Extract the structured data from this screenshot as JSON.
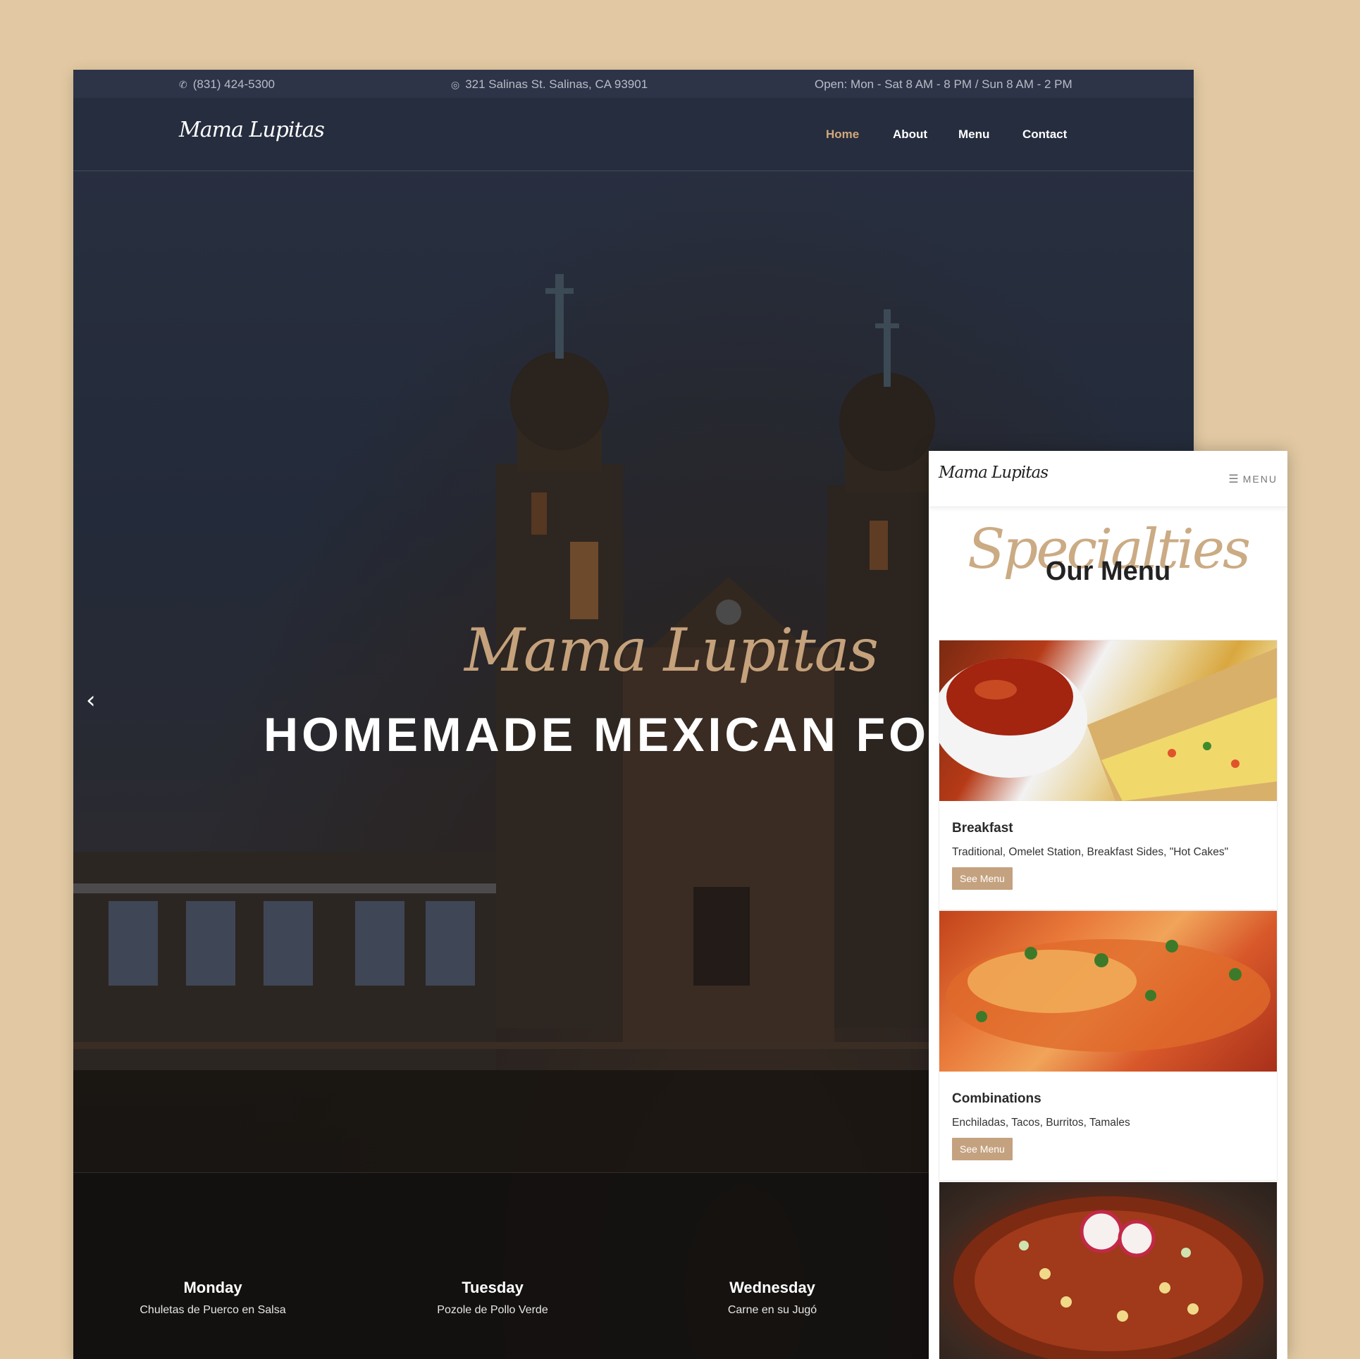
{
  "desktop": {
    "topbar": {
      "phone": "(831) 424-5300",
      "address": "321 Salinas St. Salinas, CA 93901",
      "hours": "Open: Mon - Sat 8 AM - 8 PM / Sun 8 AM - 2 PM"
    },
    "logo": "Mama Lupitas",
    "nav": {
      "home": "Home",
      "about": "About",
      "menu": "Menu",
      "contact": "Contact"
    },
    "hero": {
      "script": "Mama Lupitas",
      "title": "HOMEMADE MEXICAN FOOD",
      "prev_arrow": "‹"
    },
    "specials": [
      {
        "day": "Monday",
        "dish": "Chuletas de Puerco en Salsa"
      },
      {
        "day": "Tuesday",
        "dish": "Pozole de Pollo Verde"
      },
      {
        "day": "Wednesday",
        "dish": "Carne en su Jugó"
      }
    ]
  },
  "mobile": {
    "logo": "Mama Lupitas",
    "menu_button": "MENU",
    "script": "Specialties",
    "heading": "Our Menu",
    "cards": [
      {
        "title": "Breakfast",
        "desc": "Traditional, Omelet Station, Breakfast Sides, \"Hot Cakes\"",
        "button": "See Menu"
      },
      {
        "title": "Combinations",
        "desc": "Enchiladas, Tacos, Burritos, Tamales",
        "button": "See Menu"
      }
    ]
  },
  "icons": {
    "phone": "phone-icon",
    "location": "location-pin-icon",
    "prev": "chevron-left-icon",
    "burger": "hamburger-menu-icon"
  },
  "colors": {
    "page_bg": "#e2c9a3",
    "accent": "#c4a27f",
    "nav_active": "#d2a77a",
    "dark": "#1b2130"
  }
}
